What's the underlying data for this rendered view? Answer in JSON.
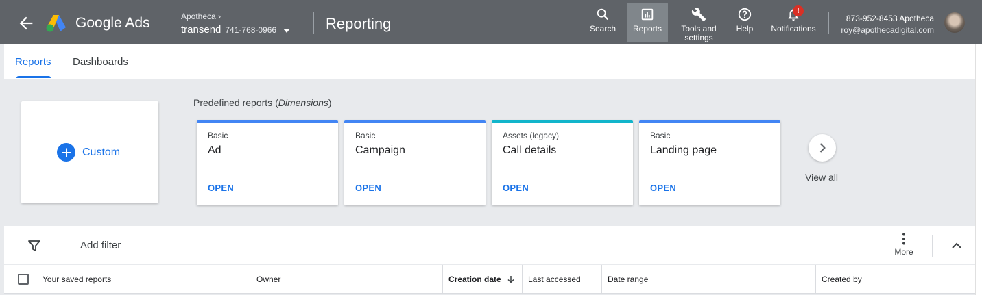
{
  "topbar": {
    "brand": "Google Ads",
    "account_parent": "Apotheca",
    "account_name": "transend",
    "account_id": "741-768-0966",
    "page_title": "Reporting",
    "nav": {
      "search": "Search",
      "reports": "Reports",
      "tools_line1": "Tools and",
      "tools_line2": "settings",
      "help": "Help",
      "notifications": "Notifications",
      "notification_badge": "!"
    },
    "user_phone": "873-952-8453 Apotheca",
    "user_email": "roy@apothecadigital.com"
  },
  "tabs": {
    "reports": "Reports",
    "dashboards": "Dashboards"
  },
  "gallery": {
    "custom_label": "Custom",
    "predefined_title": "Predefined reports (",
    "predefined_italic": "Dimensions",
    "predefined_close": ")",
    "cards": [
      {
        "category": "Basic",
        "name": "Ad",
        "action": "OPEN",
        "color": "#4285f4"
      },
      {
        "category": "Basic",
        "name": "Campaign",
        "action": "OPEN",
        "color": "#4285f4"
      },
      {
        "category": "Assets (legacy)",
        "name": "Call details",
        "action": "OPEN",
        "color": "#12b5cb"
      },
      {
        "category": "Basic",
        "name": "Landing page",
        "action": "OPEN",
        "color": "#4285f4"
      }
    ],
    "view_all": "View all"
  },
  "filterbar": {
    "add_filter": "Add filter",
    "more": "More"
  },
  "table": {
    "columns": [
      "Your saved reports",
      "Owner",
      "Creation date",
      "Last accessed",
      "Date range",
      "Created by"
    ]
  },
  "colors": {
    "accent": "#1a73e8",
    "topbar": "#5f6368",
    "badge": "#d93025"
  }
}
